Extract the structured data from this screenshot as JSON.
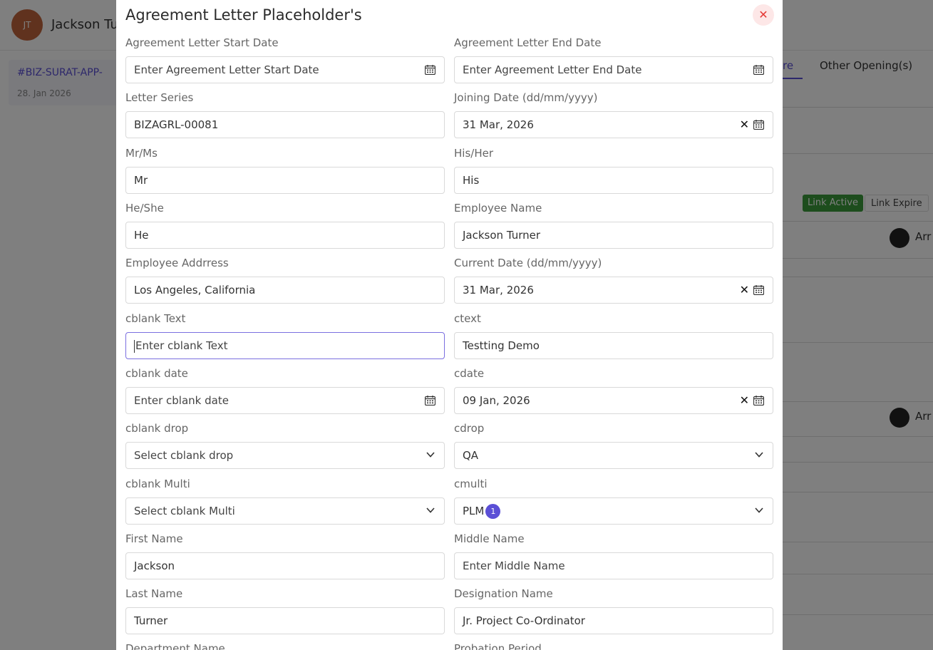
{
  "background": {
    "avatar_initials": "JT",
    "user_name": "Jackson Tu",
    "ticket": "#BIZ-SURAT-APP-",
    "date": "28. Jan 2026",
    "tab_partial": "re",
    "tab_other": "Other Opening(s)",
    "link_active": "Link Active",
    "link_expire": "Link Expire",
    "row_name_partial": "Arr"
  },
  "modal": {
    "title": "Agreement Letter Placeholder's",
    "close_symbol": "✕"
  },
  "fields": {
    "agreement_start": {
      "label": "Agreement Letter Start Date",
      "value": "Enter Agreement Letter Start Date"
    },
    "agreement_end": {
      "label": "Agreement Letter End Date",
      "value": "Enter Agreement Letter End Date"
    },
    "letter_series": {
      "label": "Letter Series",
      "value": "BIZAGRL-00081"
    },
    "joining_date": {
      "label": "Joining Date (dd/mm/yyyy)",
      "value": "31 Mar, 2026"
    },
    "mr_ms": {
      "label": "Mr/Ms",
      "value": "Mr"
    },
    "his_her": {
      "label": "His/Her",
      "value": "His"
    },
    "he_she": {
      "label": "He/She",
      "value": "He"
    },
    "employee_name": {
      "label": "Employee Name",
      "value": "Jackson Turner"
    },
    "employee_address": {
      "label": "Employee Addrress",
      "value": "Los Angeles, California"
    },
    "current_date": {
      "label": "Current Date (dd/mm/yyyy)",
      "value": "31 Mar, 2026"
    },
    "cblank_text": {
      "label": "cblank Text",
      "value": "Enter cblank Text"
    },
    "ctext": {
      "label": "ctext",
      "value": "Testting Demo"
    },
    "cblank_date": {
      "label": "cblank date",
      "value": "Enter cblank date"
    },
    "cdate": {
      "label": "cdate",
      "value": "09 Jan, 2026"
    },
    "cblank_drop": {
      "label": "cblank drop",
      "value": "Select cblank drop"
    },
    "cdrop": {
      "label": "cdrop",
      "value": "QA"
    },
    "cblank_multi": {
      "label": "cblank Multi",
      "value": "Select cblank Multi"
    },
    "cmulti": {
      "label": "cmulti",
      "value": "PLM",
      "badge": "1"
    },
    "first_name": {
      "label": "First Name",
      "value": "Jackson"
    },
    "middle_name": {
      "label": "Middle Name",
      "value": "Enter Middle Name"
    },
    "last_name": {
      "label": "Last Name",
      "value": "Turner"
    },
    "designation_name": {
      "label": "Designation Name",
      "value": "Jr. Project Co-Ordinator"
    },
    "department_name": {
      "label": "Department Name"
    },
    "probation_period": {
      "label": "Probation Period"
    }
  },
  "icons": {
    "clear": "✕"
  },
  "colors": {
    "accent": "#5b4fd6",
    "close_bg": "#fde7e7",
    "close_fg": "#e53935",
    "link_active": "#3a9a3a"
  }
}
